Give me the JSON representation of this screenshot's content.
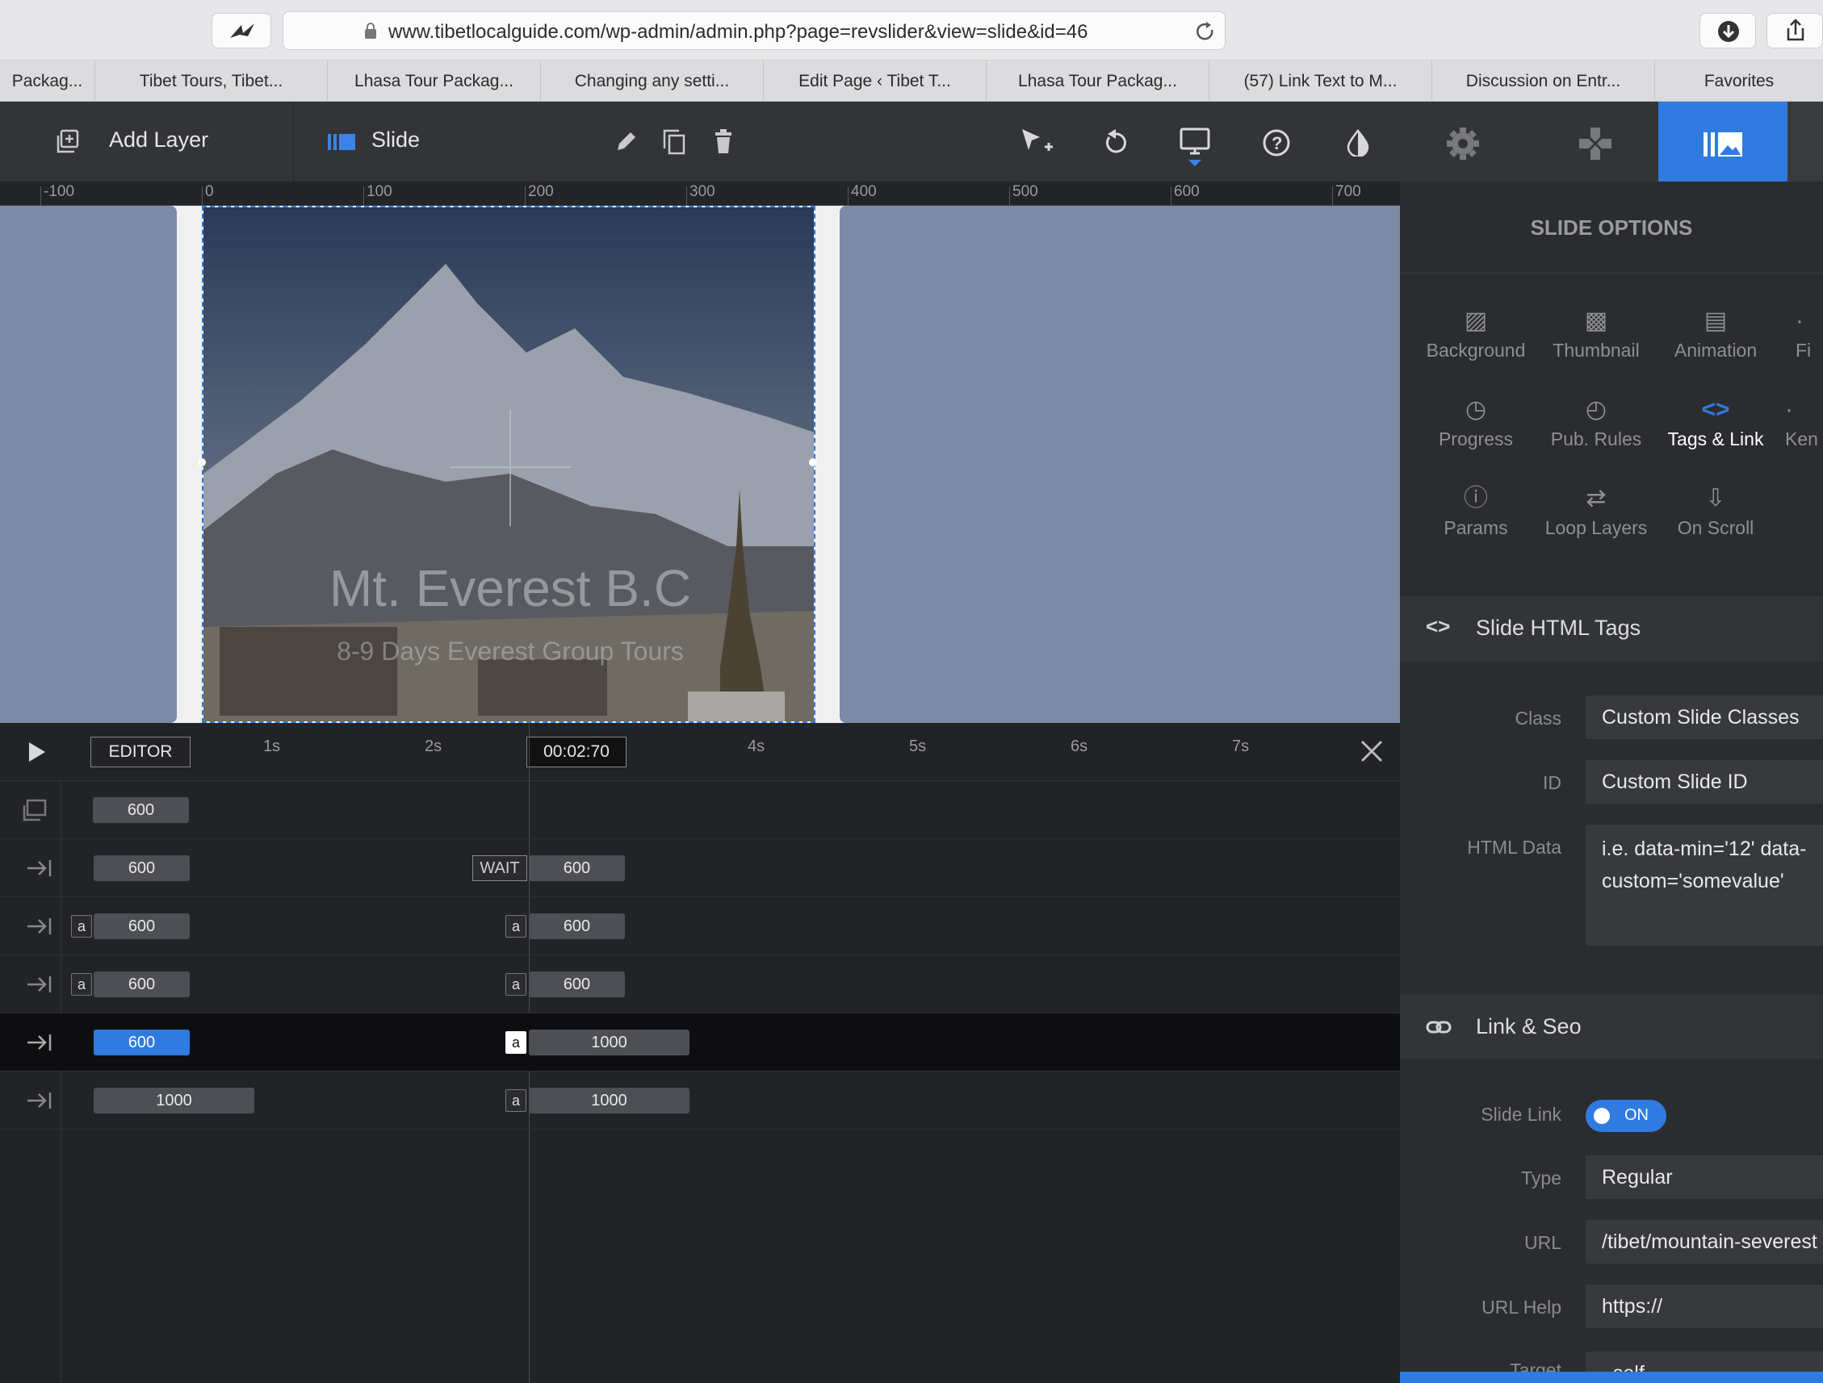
{
  "browser": {
    "url": "www.tibetlocalguide.com/wp-admin/admin.php?page=revslider&view=slide&id=46",
    "bookmarks": [
      "Packag...",
      "Tibet Tours, Tibet...",
      "Lhasa Tour Packag...",
      "Changing any setti...",
      "Edit Page ‹ Tibet T...",
      "Lhasa Tour Packag...",
      "(57) Link Text to M...",
      "Discussion on Entr...",
      "Favorites"
    ]
  },
  "toolbar": {
    "add_layer": "Add Layer",
    "slide": "Slide"
  },
  "ruler": [
    "-100",
    "0",
    "100",
    "200",
    "300",
    "400",
    "500",
    "600",
    "700"
  ],
  "slide": {
    "title": "Mt. Everest B.C",
    "subtitle": "8-9 Days Everest Group Tours"
  },
  "timeline": {
    "editor_label": "EDITOR",
    "current_time": "00:02:70",
    "seconds": [
      "1s",
      "2s",
      "4s",
      "5s",
      "6s",
      "7s"
    ],
    "wait_label": "WAIT",
    "a_label": "a",
    "rows": [
      {
        "start": "600",
        "end": ""
      },
      {
        "start": "600",
        "end": "600"
      },
      {
        "start": "600",
        "end": "600"
      },
      {
        "start": "600",
        "end": "600"
      },
      {
        "start": "600",
        "end": "1000"
      },
      {
        "start": "1000",
        "end": "1000"
      }
    ]
  },
  "panel": {
    "header": "SLIDE OPTIONS",
    "options": [
      {
        "label": "Background",
        "icon": "image-icon"
      },
      {
        "label": "Thumbnail",
        "icon": "thumbnail-icon"
      },
      {
        "label": "Animation",
        "icon": "clapper-icon"
      },
      {
        "label": "Fi",
        "icon": "filter-icon"
      },
      {
        "label": "Progress",
        "icon": "stopwatch-icon"
      },
      {
        "label": "Pub. Rules",
        "icon": "clock-icon"
      },
      {
        "label": "Tags & Link",
        "icon": "code-icon"
      },
      {
        "label": "Ken",
        "icon": "ken-burns-icon"
      },
      {
        "label": "Params",
        "icon": "info-icon"
      },
      {
        "label": "Loop Layers",
        "icon": "loop-icon"
      },
      {
        "label": "On Scroll",
        "icon": "download-icon"
      }
    ],
    "html_tags_title": "Slide HTML Tags",
    "class_label": "Class",
    "class_value": "Custom Slide Classes",
    "id_label": "ID",
    "id_value": "Custom Slide ID",
    "html_data_label": "HTML Data",
    "html_data_value1": "i.e. data-min='12' data-",
    "html_data_value2": "custom='somevalue'",
    "link_title": "Link & Seo",
    "slide_link_label": "Slide Link",
    "slide_link_value": "ON",
    "type_label": "Type",
    "type_value": "Regular",
    "url_label": "URL",
    "url_value": "/tibet/mountain-severest",
    "url_help_label": "URL Help",
    "url_help_value": "https://",
    "target_label": "Target",
    "target_value": "_self"
  },
  "colors": {
    "accent": "#2f7be0",
    "panel": "#2b2c30",
    "stage": "#7b8aa6"
  }
}
